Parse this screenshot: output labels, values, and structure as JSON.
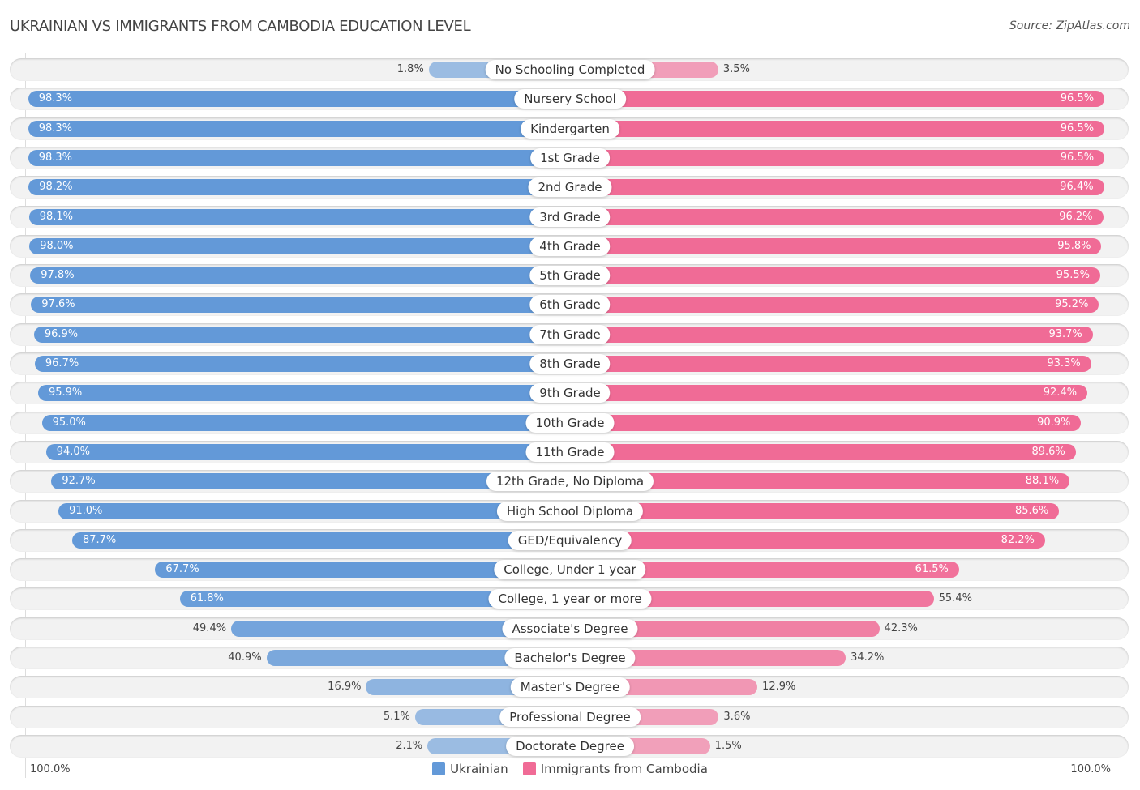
{
  "header": {
    "title": "UKRAINIAN VS IMMIGRANTS FROM CAMBODIA EDUCATION LEVEL",
    "source": "Source: ZipAtlas.com"
  },
  "axis": {
    "left_label": "100.0%",
    "right_label": "100.0%"
  },
  "legend": [
    {
      "label": "Ukrainian",
      "color": "#6399d8"
    },
    {
      "label": "Immigrants from Cambodia",
      "color": "#f06b96"
    }
  ],
  "chart_data": {
    "type": "bar",
    "orientation": "horizontal-diverging",
    "title": "UKRAINIAN VS IMMIGRANTS FROM CAMBODIA EDUCATION LEVEL",
    "xlabel": "",
    "ylabel": "",
    "xlim": [
      0,
      100
    ],
    "legend_position": "bottom-center",
    "categories": [
      "No Schooling Completed",
      "Nursery School",
      "Kindergarten",
      "1st Grade",
      "2nd Grade",
      "3rd Grade",
      "4th Grade",
      "5th Grade",
      "6th Grade",
      "7th Grade",
      "8th Grade",
      "9th Grade",
      "10th Grade",
      "11th Grade",
      "12th Grade, No Diploma",
      "High School Diploma",
      "GED/Equivalency",
      "College, Under 1 year",
      "College, 1 year or more",
      "Associate's Degree",
      "Bachelor's Degree",
      "Master's Degree",
      "Professional Degree",
      "Doctorate Degree"
    ],
    "series": [
      {
        "name": "Ukrainian",
        "color": "#6399d8",
        "side": "left",
        "values": [
          1.8,
          98.3,
          98.3,
          98.3,
          98.2,
          98.1,
          98.0,
          97.8,
          97.6,
          96.9,
          96.7,
          95.9,
          95.0,
          94.0,
          92.7,
          91.0,
          87.7,
          67.7,
          61.8,
          49.4,
          40.9,
          16.9,
          5.1,
          2.1
        ],
        "labels": [
          "1.8%",
          "98.3%",
          "98.3%",
          "98.3%",
          "98.2%",
          "98.1%",
          "98.0%",
          "97.8%",
          "97.6%",
          "96.9%",
          "96.7%",
          "95.9%",
          "95.0%",
          "94.0%",
          "92.7%",
          "91.0%",
          "87.7%",
          "67.7%",
          "61.8%",
          "49.4%",
          "40.9%",
          "16.9%",
          "5.1%",
          "2.1%"
        ]
      },
      {
        "name": "Immigrants from Cambodia",
        "color": "#f06b96",
        "side": "right",
        "values": [
          3.5,
          96.5,
          96.5,
          96.5,
          96.4,
          96.2,
          95.8,
          95.5,
          95.2,
          93.7,
          93.3,
          92.4,
          90.9,
          89.6,
          88.1,
          85.6,
          82.2,
          61.5,
          55.4,
          42.3,
          34.2,
          12.9,
          3.6,
          1.5
        ],
        "labels": [
          "3.5%",
          "96.5%",
          "96.5%",
          "96.5%",
          "96.4%",
          "96.2%",
          "95.8%",
          "95.5%",
          "95.2%",
          "93.7%",
          "93.3%",
          "92.4%",
          "90.9%",
          "89.6%",
          "88.1%",
          "85.6%",
          "82.2%",
          "61.5%",
          "55.4%",
          "42.3%",
          "34.2%",
          "12.9%",
          "3.6%",
          "1.5%"
        ]
      }
    ]
  }
}
